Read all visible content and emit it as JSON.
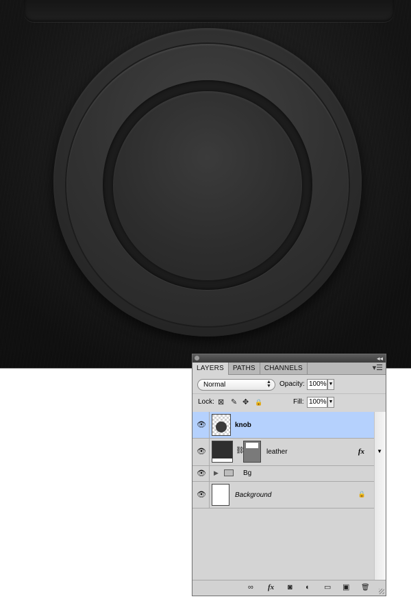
{
  "panel": {
    "tabs": [
      {
        "label": "LAYERS",
        "active": true
      },
      {
        "label": "PATHS",
        "active": false
      },
      {
        "label": "CHANNELS",
        "active": false
      }
    ],
    "collapse_glyph": "◂◂",
    "menu_glyph": "▾☰",
    "blend_mode": "Normal",
    "opacity_label": "Opacity:",
    "opacity_value": "100%",
    "lock_label": "Lock:",
    "fill_label": "Fill:",
    "fill_value": "100%",
    "lock_icons": {
      "transparent": "⊠",
      "paint": "✎",
      "move": "✥",
      "all": "🔒"
    },
    "layers": [
      {
        "name": "knob",
        "selected": true,
        "bold": true,
        "italic": false
      },
      {
        "name": "leather",
        "selected": false,
        "bold": false,
        "italic": false,
        "fx": "fx"
      },
      {
        "name": "Bg",
        "selected": false,
        "bold": false,
        "italic": false,
        "group": true
      },
      {
        "name": "Background",
        "selected": false,
        "bold": false,
        "italic": true,
        "locked": true
      }
    ],
    "bottom_icons": {
      "link": "∞",
      "fx": "fx",
      "mask": "◙",
      "adjustment": "◐",
      "group": "▭",
      "new": "▣",
      "delete": "🗑"
    }
  },
  "colors": {
    "selected_layer": "#b5d1fd",
    "panel_bg": "#d6d6d6",
    "canvas_bg": "#1c1c1c"
  }
}
